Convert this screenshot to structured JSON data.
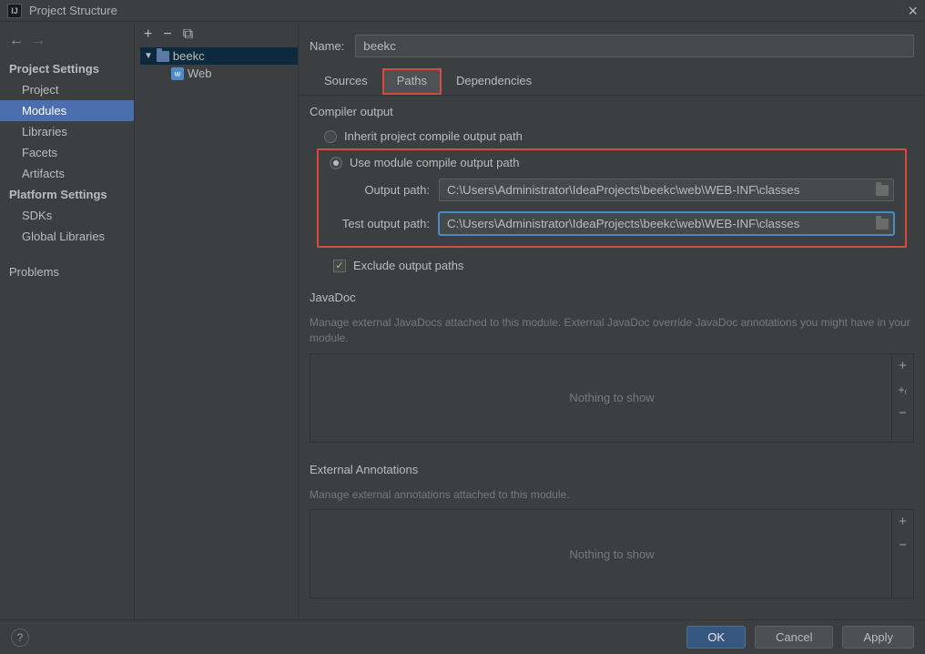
{
  "window": {
    "title": "Project Structure"
  },
  "sidebar": {
    "project_section": "Project Settings",
    "platform_section": "Platform Settings",
    "items_project": [
      "Project",
      "Modules",
      "Libraries",
      "Facets",
      "Artifacts"
    ],
    "items_platform": [
      "SDKs",
      "Global Libraries"
    ],
    "problems": "Problems",
    "selected": "Modules"
  },
  "tree": {
    "module_name": "beekc",
    "child_name": "Web"
  },
  "name_field": {
    "label": "Name:",
    "value": "beekc"
  },
  "tabs": {
    "sources": "Sources",
    "paths": "Paths",
    "dependencies": "Dependencies"
  },
  "compiler": {
    "section": "Compiler output",
    "inherit_label": "Inherit project compile output path",
    "module_label": "Use module compile output path",
    "output_label": "Output path:",
    "output_value": "C:\\Users\\Administrator\\IdeaProjects\\beekc\\web\\WEB-INF\\classes",
    "test_label": "Test output path:",
    "test_value": "C:\\Users\\Administrator\\IdeaProjects\\beekc\\web\\WEB-INF\\classes",
    "exclude_label": "Exclude output paths"
  },
  "javadoc": {
    "section": "JavaDoc",
    "desc": "Manage external JavaDocs attached to this module. External JavaDoc override JavaDoc annotations you might have in your module.",
    "empty": "Nothing to show"
  },
  "annotations": {
    "section": "External Annotations",
    "desc": "Manage external annotations attached to this module.",
    "empty": "Nothing to show"
  },
  "footer": {
    "ok": "OK",
    "cancel": "Cancel",
    "apply": "Apply"
  }
}
